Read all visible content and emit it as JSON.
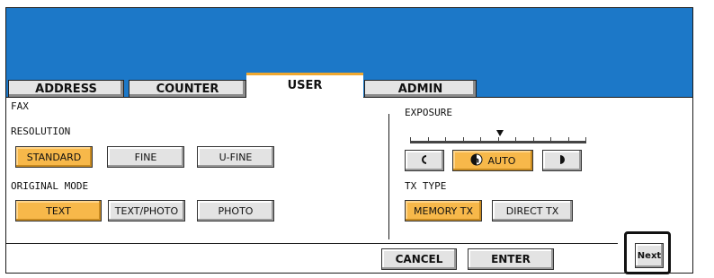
{
  "tabs": {
    "address": "ADDRESS",
    "counter": "COUNTER",
    "user": "USER",
    "admin": "ADMIN"
  },
  "fax": {
    "section_label": "FAX",
    "resolution_label": "RESOLUTION",
    "resolution_options": [
      "STANDARD",
      "FINE",
      "U-FINE"
    ],
    "resolution_selected": "STANDARD",
    "original_mode_label": "ORIGINAL MODE",
    "original_mode_options": [
      "TEXT",
      "TEXT/PHOTO",
      "PHOTO"
    ],
    "original_mode_selected": "TEXT",
    "exposure_label": "EXPOSURE",
    "exposure_auto": "AUTO",
    "tx_type_label": "TX TYPE",
    "tx_type_options": [
      "MEMORY TX",
      "DIRECT TX"
    ],
    "tx_type_selected": "MEMORY TX"
  },
  "footer": {
    "cancel": "CANCEL",
    "enter": "ENTER",
    "next": "Next"
  },
  "colors": {
    "header_blue": "#1c78c8",
    "selected_orange": "#f7b84a",
    "active_tab_accent": "#f0a830",
    "button_gray": "#e3e3e3"
  }
}
